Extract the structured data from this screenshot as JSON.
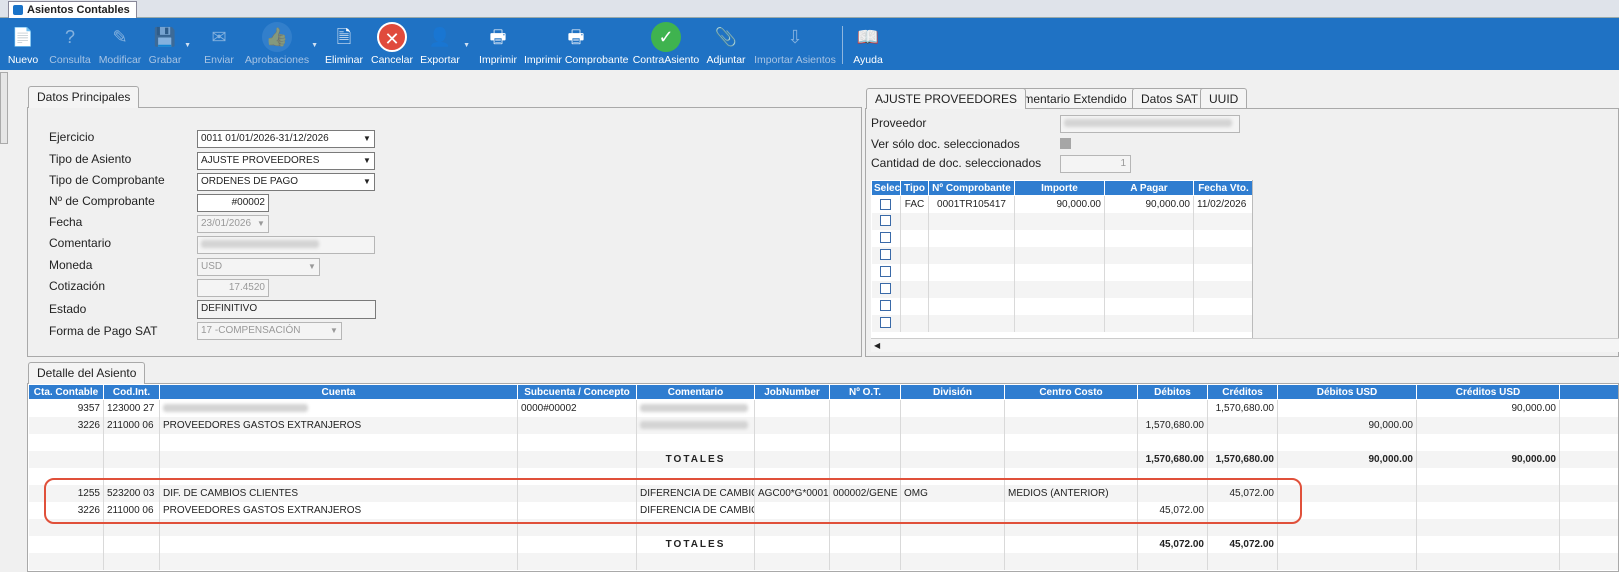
{
  "window": {
    "tab_title": "Asientos Contables"
  },
  "toolbar": {
    "nuevo": "Nuevo",
    "consulta": "Consulta",
    "modificar": "Modificar",
    "grabar": "Grabar",
    "enviar": "Enviar",
    "aprobaciones": "Aprobaciones",
    "eliminar": "Eliminar",
    "cancelar": "Cancelar",
    "exportar": "Exportar",
    "imprimir": "Imprimir",
    "imprimir_comprobante": "Imprimir Comprobante",
    "contra_asiento": "ContraAsiento",
    "adjuntar": "Adjuntar",
    "importar_asientos": "Importar Asientos",
    "ayuda": "Ayuda"
  },
  "datos_principales": {
    "title": "Datos Principales",
    "labels": {
      "ejercicio": "Ejercicio",
      "tipo_asiento": "Tipo de Asiento",
      "tipo_comprobante": "Tipo de Comprobante",
      "nro_comprobante": "Nº de Comprobante",
      "fecha": "Fecha",
      "comentario": "Comentario",
      "moneda": "Moneda",
      "cotizacion": "Cotización",
      "estado": "Estado",
      "forma_pago": "Forma de Pago SAT"
    },
    "values": {
      "ejercicio": "0011 01/01/2026-31/12/2026",
      "tipo_asiento": "AJUSTE PROVEEDORES",
      "tipo_comprobante": "ORDENES DE PAGO",
      "nro_comprobante": "#00002",
      "fecha": "23/01/2026",
      "comentario": "",
      "moneda": "USD",
      "cotizacion": "17.4520",
      "estado": "DEFINITIVO",
      "forma_pago": "17 -COMPENSACIÓN"
    }
  },
  "right_panel": {
    "tabs": [
      "AJUSTE PROVEEDORES",
      "Comentario Extendido",
      "Datos SAT",
      "UUID"
    ],
    "labels": {
      "proveedor": "Proveedor",
      "ver_solo": "Ver sólo doc. seleccionados",
      "cantidad": "Cantidad de doc. seleccionados"
    },
    "cantidad_value": "1",
    "columns": [
      "Selec",
      "Tipo",
      "Nº Comprobante",
      "Importe",
      "A Pagar",
      "Fecha Vto."
    ],
    "rows": [
      {
        "tipo": "FAC",
        "comprobante": "0001TR105417",
        "importe": "90,000.00",
        "a_pagar": "90,000.00",
        "fecha": "11/02/2026"
      }
    ]
  },
  "detalle": {
    "title": "Detalle del Asiento",
    "columns": [
      "Cta. Contable",
      "Cod.Int.",
      "Cuenta",
      "Subcuenta / Concepto",
      "Comentario",
      "JobNumber",
      "Nº O.T.",
      "División",
      "Centro Costo",
      "Débitos",
      "Créditos",
      "Débitos USD",
      "Créditos USD"
    ],
    "rows": [
      {
        "cta": "9357",
        "cod": "123000 27",
        "cuenta": "",
        "subcuenta": "0000#00002",
        "comentario": "",
        "job": "",
        "ot": "",
        "division": "",
        "cc": "",
        "debitos": "",
        "creditos": "1,570,680.00",
        "deb_usd": "",
        "cred_usd": "90,000.00"
      },
      {
        "cta": "3226",
        "cod": "211000 06",
        "cuenta": "PROVEEDORES GASTOS EXTRANJEROS",
        "subcuenta": "",
        "comentario": "",
        "job": "",
        "ot": "",
        "division": "",
        "cc": "",
        "debitos": "1,570,680.00",
        "creditos": "",
        "deb_usd": "90,000.00",
        "cred_usd": ""
      }
    ],
    "totales_label": "TOTALES",
    "totales1": {
      "debitos": "1,570,680.00",
      "creditos": "1,570,680.00",
      "deb_usd": "90,000.00",
      "cred_usd": "90,000.00"
    },
    "rows2": [
      {
        "cta": "1255",
        "cod": "523200 03",
        "cuenta": "DIF. DE CAMBIOS CLIENTES",
        "comentario": "DIFERENCIA DE CAMBIO",
        "job": "AGC00*G*0001",
        "ot": "000002/GENE",
        "division": "OMG",
        "cc": "MEDIOS (ANTERIOR)",
        "debitos": "",
        "creditos": "45,072.00"
      },
      {
        "cta": "3226",
        "cod": "211000 06",
        "cuenta": "PROVEEDORES GASTOS EXTRANJEROS",
        "comentario": "DIFERENCIA DE CAMBIO",
        "job": "",
        "ot": "",
        "division": "",
        "cc": "",
        "debitos": "45,072.00",
        "creditos": ""
      }
    ],
    "totales2": {
      "debitos": "45,072.00",
      "creditos": "45,072.00"
    }
  },
  "colors": {
    "toolbar": "#1f72c4",
    "grid_header": "#2f7dd0",
    "highlight": "#e0503a"
  },
  "icons": [
    "new-doc-icon",
    "query-icon",
    "edit-icon",
    "save-icon",
    "envelope-icon",
    "thumbs-up-icon",
    "delete-doc-icon",
    "cancel-icon",
    "user-export-icon",
    "printer-icon",
    "printer-icon",
    "check-icon",
    "attach-doc-icon",
    "import-icon",
    "help-book-icon"
  ]
}
